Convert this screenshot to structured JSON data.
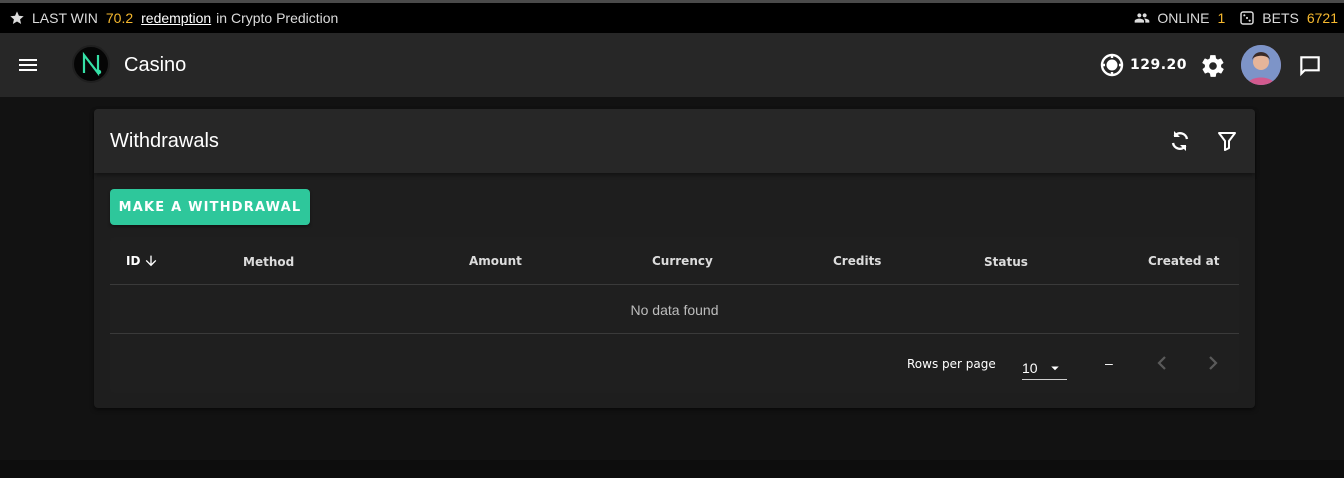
{
  "ticker": {
    "last_win_label": "LAST WIN",
    "last_win_value": "70.2",
    "username": "redemption",
    "game_text": "in Crypto Prediction",
    "online_label": "ONLINE",
    "online_count": "1",
    "bets_label": "BETS",
    "bets_count": "6721"
  },
  "appbar": {
    "logo_letter": "N",
    "brand": "Casino",
    "balance": "129.20"
  },
  "withdrawals": {
    "title": "Withdrawals",
    "make_button": "MAKE A WITHDRAWAL",
    "columns": [
      "ID",
      "Method",
      "Amount",
      "Currency",
      "Credits",
      "Status",
      "Created at"
    ],
    "empty_text": "No data found",
    "rows_per_page_label": "Rows per page",
    "rows_per_page_value": "10",
    "page_range": "–"
  },
  "colors": {
    "accent": "#2ec79b",
    "highlight": "#f5b82e",
    "appbar": "#272727",
    "background": "#121212"
  },
  "icons": [
    "star-icon",
    "users-icon",
    "dice-icon",
    "menu-icon",
    "chip-icon",
    "gear-icon",
    "chat-icon",
    "refresh-icon",
    "filter-icon",
    "arrow-down-icon",
    "caret-down-icon",
    "chevron-left-icon",
    "chevron-right-icon"
  ]
}
